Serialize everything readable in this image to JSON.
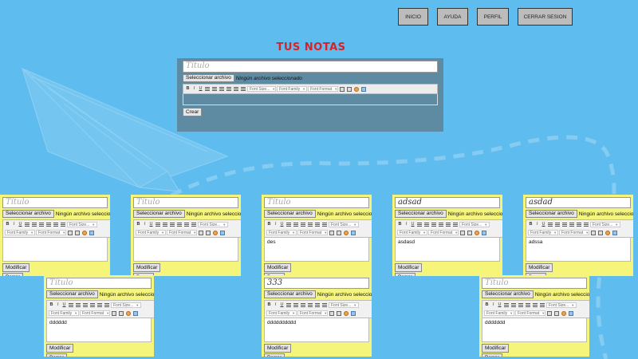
{
  "nav": {
    "inicio": "INICIO",
    "ayuda": "AYUDA",
    "perfil": "PERFIL",
    "cerrar": "CERRAR SESION"
  },
  "page_title": "TUS NOTAS",
  "create": {
    "title_placeholder": "Título",
    "file_button": "Seleccionar archivo",
    "file_status": "Ningún archivo seleccionado",
    "font_size": "Font Size...",
    "font_family": "Font Family",
    "font_format": "Font Format",
    "create_button": "Crear"
  },
  "notes": [
    {
      "title": "",
      "placeholder": "Título",
      "body": ""
    },
    {
      "title": "",
      "placeholder": "Título",
      "body": ""
    },
    {
      "title": "",
      "placeholder": "Título",
      "body": "des"
    },
    {
      "title": "adsad",
      "placeholder": "Título",
      "body": "asdasd"
    },
    {
      "title": "asdad",
      "placeholder": "Título",
      "body": "adssa"
    },
    {
      "title": "",
      "placeholder": "Título",
      "body": "dddddd"
    },
    {
      "title": "333",
      "placeholder": "Título",
      "body": "dddddddddd"
    },
    {
      "title": "",
      "placeholder": "Título",
      "body": "ddddddd"
    }
  ],
  "note_labels": {
    "file_button": "Seleccionar archivo",
    "file_status": "Ningún archivo seleccionado",
    "font_size": "Font Size...",
    "font_family": "Font Family",
    "font_format": "Font Format",
    "modify_button": "Modificar",
    "delete_button": "Borrar"
  },
  "colors": {
    "background": "#5fbcef",
    "title_red": "#d6222a",
    "panel": "#5e8ba2",
    "note_yellow": "#f5f57c"
  }
}
